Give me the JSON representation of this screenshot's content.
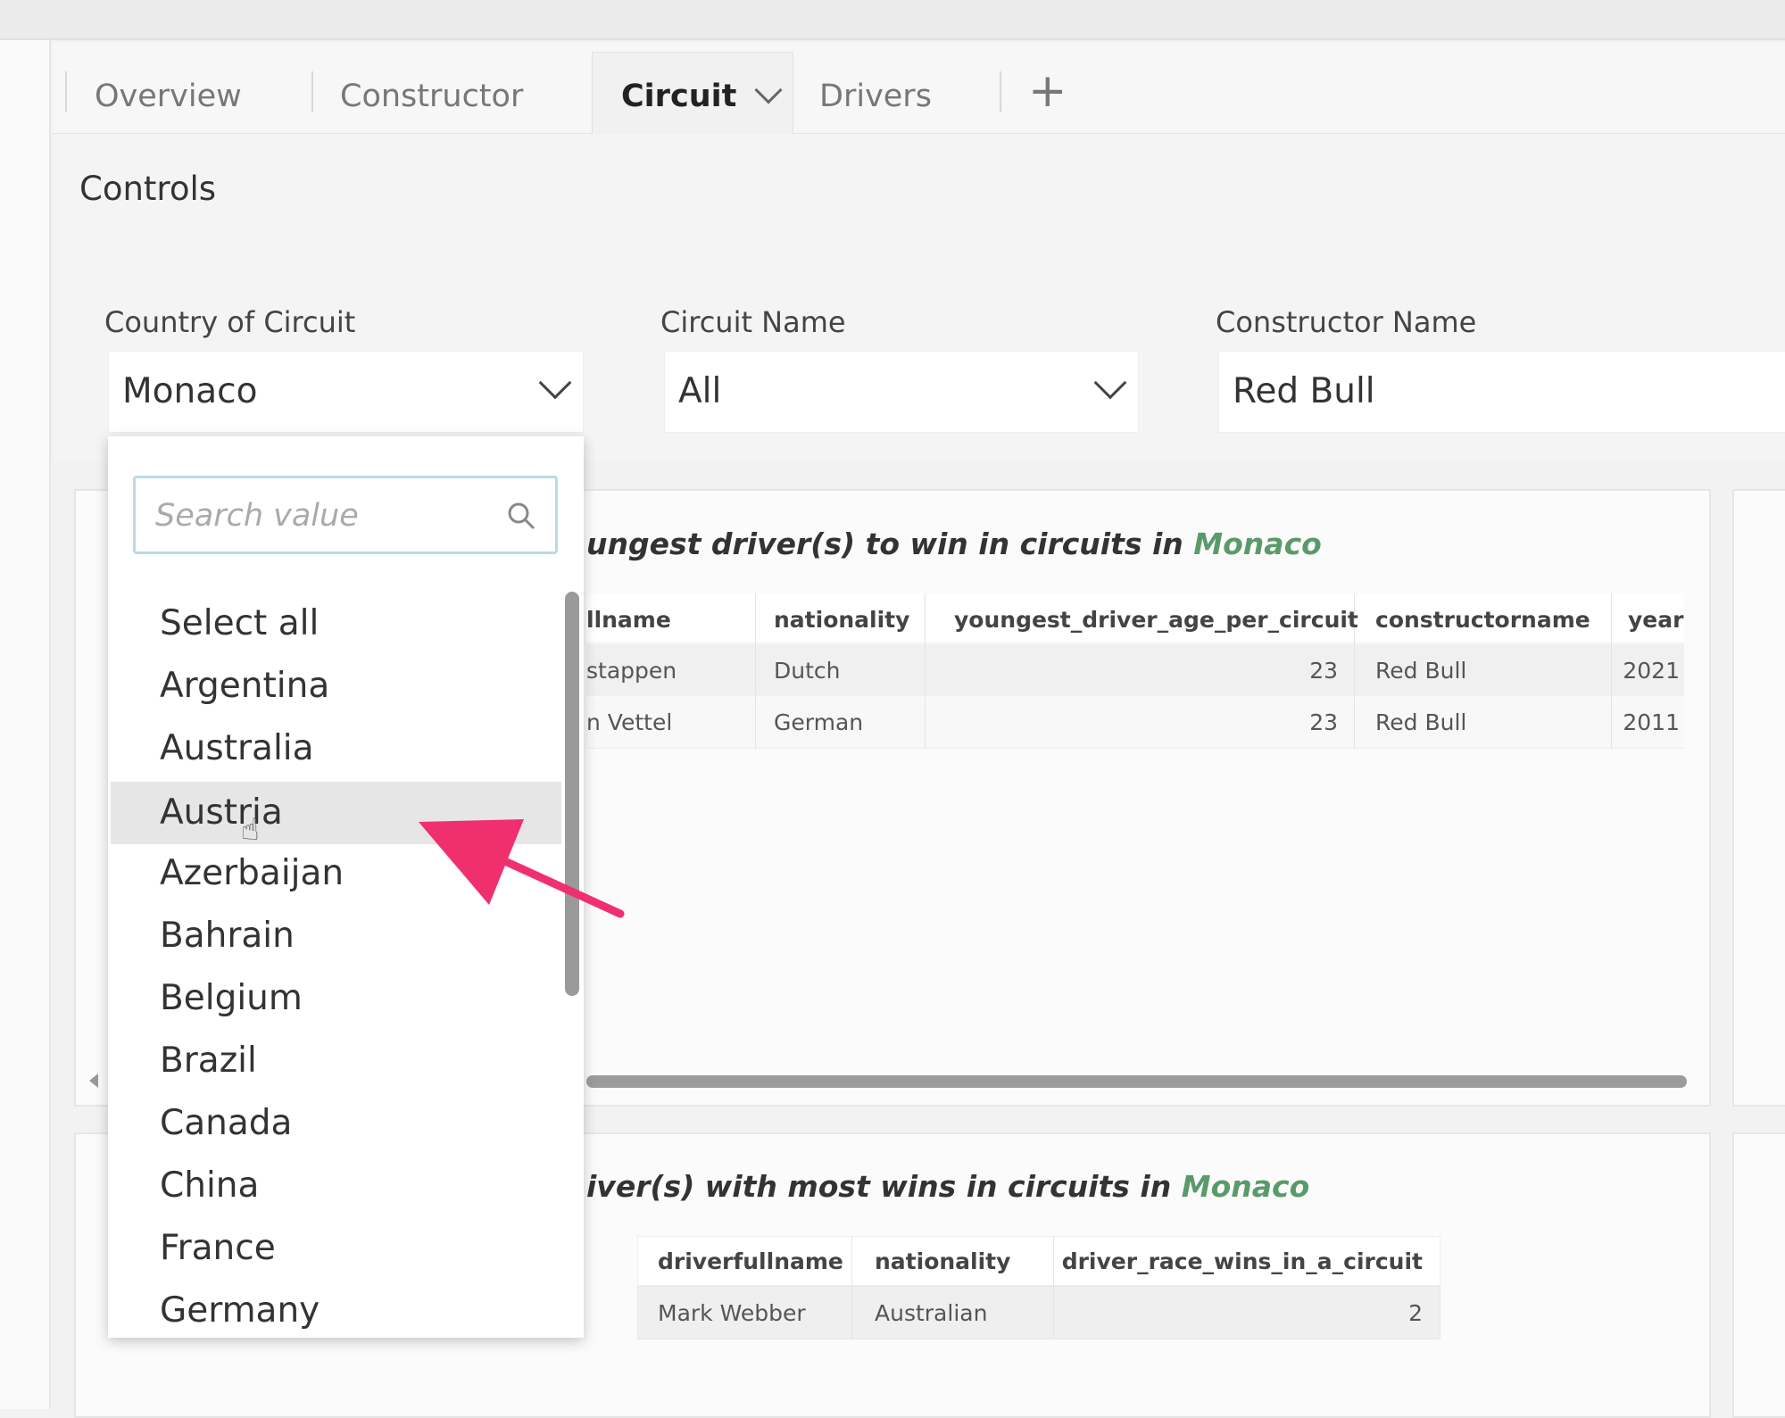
{
  "tabs": [
    {
      "label": "Overview"
    },
    {
      "label": "Constructor"
    },
    {
      "label": "Circuit",
      "active": true
    },
    {
      "label": "Drivers"
    }
  ],
  "add_tab_icon": "plus-icon",
  "controls": {
    "title": "Controls",
    "filters": [
      {
        "label": "Country of Circuit",
        "value": "Monaco"
      },
      {
        "label": "Circuit Name",
        "value": "All"
      },
      {
        "label": "Constructor Name",
        "value": "Red Bull"
      }
    ]
  },
  "dropdown": {
    "search_placeholder": "Search value",
    "items": [
      "Select all",
      "Argentina",
      "Australia",
      "Austria",
      "Azerbaijan",
      "Bahrain",
      "Belgium",
      "Brazil",
      "Canada",
      "China",
      "France",
      "Germany"
    ],
    "highlighted": "Austria"
  },
  "card1": {
    "title_prefix": "ungest driver(s) to win in circuits in ",
    "title_highlight": "Monaco",
    "columns": [
      "llname",
      "nationality",
      "youngest_driver_age_per_circuit",
      "constructorname",
      "year"
    ],
    "rows": [
      [
        "stappen",
        "Dutch",
        "23",
        "Red Bull",
        "2021"
      ],
      [
        "n Vettel",
        "German",
        "23",
        "Red Bull",
        "2011"
      ]
    ]
  },
  "card2": {
    "title_prefix": "iver(s) with most wins in circuits in ",
    "title_highlight": "Monaco",
    "columns": [
      "driverfullname",
      "nationality",
      "driver_race_wins_in_a_circuit"
    ],
    "rows": [
      [
        "Mark Webber",
        "Australian",
        "2"
      ]
    ]
  },
  "colors": {
    "accent_green": "#5a9a6a",
    "annotation_arrow": "#f0306e"
  }
}
